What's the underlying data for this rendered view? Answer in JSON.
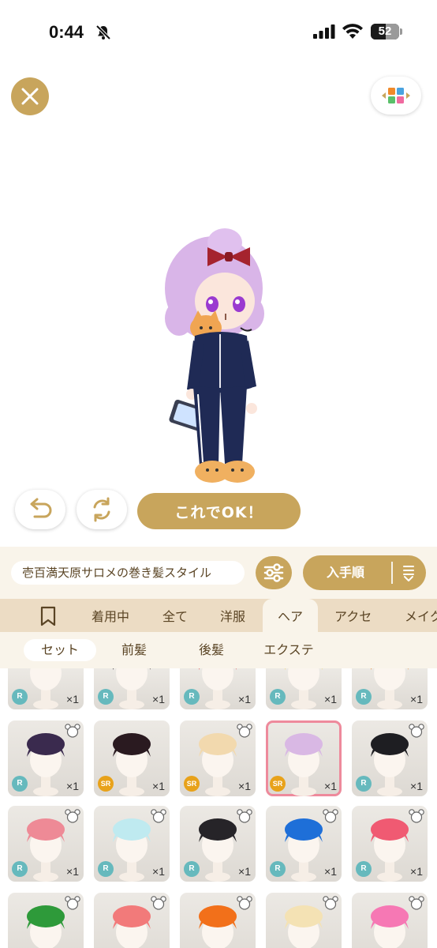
{
  "status_bar": {
    "time": "0:44",
    "battery": "52",
    "battery_level": 0.52
  },
  "main_action": {
    "ok_label": "これでOK！"
  },
  "info": {
    "item_name": "壱百満天原サロメの巻き髪スタイル",
    "sort_label": "入手順"
  },
  "category_tabs": [
    {
      "label": "着用中",
      "active": false
    },
    {
      "label": "全て",
      "active": false
    },
    {
      "label": "洋服",
      "active": false
    },
    {
      "label": "ヘア",
      "active": true
    },
    {
      "label": "アクセ",
      "active": false
    },
    {
      "label": "メイク",
      "active": false
    }
  ],
  "sub_tabs": [
    {
      "label": "セット",
      "selected": true
    },
    {
      "label": "前髪",
      "selected": false
    },
    {
      "label": "後髪",
      "selected": false
    },
    {
      "label": "エクステ",
      "selected": false
    }
  ],
  "items": [
    {
      "rarity": "R",
      "count": "×1",
      "hair": "#f0ece6",
      "partial": true
    },
    {
      "rarity": "R",
      "count": "×1",
      "hair": "#2b2226",
      "partial": true
    },
    {
      "rarity": "R",
      "count": "×1",
      "hair": "#e24a48",
      "partial": true
    },
    {
      "rarity": "R",
      "count": "×1",
      "hair": "#f6d86a",
      "partial": true
    },
    {
      "rarity": "R",
      "count": "×1",
      "hair": "#f08a2a",
      "partial": true
    },
    {
      "rarity": "R",
      "count": "×1",
      "hair": "#3a2a4e",
      "bear": true
    },
    {
      "rarity": "SR",
      "count": "×1",
      "hair": "#2a1a20",
      "bear": false
    },
    {
      "rarity": "SR",
      "count": "×1",
      "hair": "#f2d9ae",
      "bear": true
    },
    {
      "rarity": "SR",
      "count": "×1",
      "hair": "#d9b8e4",
      "bear": false,
      "selected": true
    },
    {
      "rarity": "R",
      "count": "×1",
      "hair": "#1e1e22",
      "bear": true
    },
    {
      "rarity": "R",
      "count": "×1",
      "hair": "#ee8a96",
      "bear": true
    },
    {
      "rarity": "R",
      "count": "×1",
      "hair": "#bfeaf0",
      "bear": true
    },
    {
      "rarity": "R",
      "count": "×1",
      "hair": "#262428",
      "bear": true
    },
    {
      "rarity": "R",
      "count": "×1",
      "hair": "#1e6fd8",
      "bear": true
    },
    {
      "rarity": "R",
      "count": "×1",
      "hair": "#f05a72",
      "bear": true
    },
    {
      "rarity": "",
      "count": "",
      "hair": "#2e9a3a",
      "bear": true
    },
    {
      "rarity": "",
      "count": "",
      "hair": "#f27a7a",
      "bear": true
    },
    {
      "rarity": "",
      "count": "",
      "hair": "#f2701a",
      "bear": true
    },
    {
      "rarity": "",
      "count": "",
      "hair": "#f4e2b4",
      "bear": true
    },
    {
      "rarity": "",
      "count": "",
      "hair": "#f678b4",
      "bear": true
    }
  ],
  "colors": {
    "accent": "#c8a55c",
    "tab_bar": "#ecdcc4",
    "panel": "#f9f4ea",
    "selected_border": "#ee8a9c"
  },
  "icons": {
    "close": "close-icon",
    "grid": "colored-grid-icon",
    "undo": "undo-icon",
    "rotate": "rotate-icon",
    "filter": "sliders-icon",
    "sort": "sort-list-icon",
    "bookmark": "bookmark-icon"
  }
}
